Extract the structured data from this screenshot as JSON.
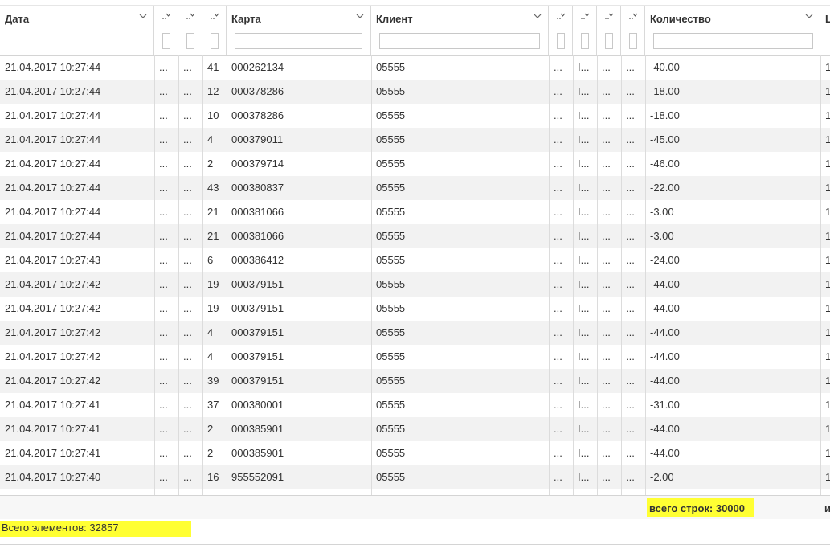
{
  "columns": {
    "date": "Дата",
    "card": "Карта",
    "client": "Клиент",
    "quantity": "Количество",
    "cut": "L",
    "collapsed_marker": "..."
  },
  "rows": [
    {
      "date": "21.04.2017 10:27:44",
      "c1": "...",
      "c2": "...",
      "n": "41",
      "card": "000262134",
      "client": "05555",
      "c4": "...",
      "c5": "I...",
      "c6": "...",
      "c7": "...",
      "qty": "-40.00",
      "cut": "1"
    },
    {
      "date": "21.04.2017 10:27:44",
      "c1": "...",
      "c2": "...",
      "n": "12",
      "card": "000378286",
      "client": "05555",
      "c4": "...",
      "c5": "I...",
      "c6": "...",
      "c7": "...",
      "qty": "-18.00",
      "cut": "1"
    },
    {
      "date": "21.04.2017 10:27:44",
      "c1": "...",
      "c2": "...",
      "n": "10",
      "card": "000378286",
      "client": "05555",
      "c4": "...",
      "c5": "I...",
      "c6": "...",
      "c7": "...",
      "qty": "-18.00",
      "cut": "1"
    },
    {
      "date": "21.04.2017 10:27:44",
      "c1": "...",
      "c2": "...",
      "n": "4",
      "card": "000379011",
      "client": "05555",
      "c4": "...",
      "c5": "I...",
      "c6": "...",
      "c7": "...",
      "qty": "-45.00",
      "cut": "1"
    },
    {
      "date": "21.04.2017 10:27:44",
      "c1": "...",
      "c2": "...",
      "n": "2",
      "card": "000379714",
      "client": "05555",
      "c4": "...",
      "c5": "I...",
      "c6": "...",
      "c7": "...",
      "qty": "-46.00",
      "cut": "1"
    },
    {
      "date": "21.04.2017 10:27:44",
      "c1": "...",
      "c2": "...",
      "n": "43",
      "card": "000380837",
      "client": "05555",
      "c4": "...",
      "c5": "I...",
      "c6": "...",
      "c7": "...",
      "qty": "-22.00",
      "cut": "1"
    },
    {
      "date": "21.04.2017 10:27:44",
      "c1": "...",
      "c2": "...",
      "n": "21",
      "card": "000381066",
      "client": "05555",
      "c4": "...",
      "c5": "I...",
      "c6": "...",
      "c7": "...",
      "qty": "-3.00",
      "cut": "1"
    },
    {
      "date": "21.04.2017 10:27:44",
      "c1": "...",
      "c2": "...",
      "n": "21",
      "card": "000381066",
      "client": "05555",
      "c4": "...",
      "c5": "I...",
      "c6": "...",
      "c7": "...",
      "qty": "-3.00",
      "cut": "1"
    },
    {
      "date": "21.04.2017 10:27:43",
      "c1": "...",
      "c2": "...",
      "n": "6",
      "card": "000386412",
      "client": "05555",
      "c4": "...",
      "c5": "I...",
      "c6": "...",
      "c7": "...",
      "qty": "-24.00",
      "cut": "1"
    },
    {
      "date": "21.04.2017 10:27:42",
      "c1": "...",
      "c2": "...",
      "n": "19",
      "card": "000379151",
      "client": "05555",
      "c4": "...",
      "c5": "I...",
      "c6": "...",
      "c7": "...",
      "qty": "-44.00",
      "cut": "1"
    },
    {
      "date": "21.04.2017 10:27:42",
      "c1": "...",
      "c2": "...",
      "n": "19",
      "card": "000379151",
      "client": "05555",
      "c4": "...",
      "c5": "I...",
      "c6": "...",
      "c7": "...",
      "qty": "-44.00",
      "cut": "1"
    },
    {
      "date": "21.04.2017 10:27:42",
      "c1": "...",
      "c2": "...",
      "n": "4",
      "card": "000379151",
      "client": "05555",
      "c4": "...",
      "c5": "I...",
      "c6": "...",
      "c7": "...",
      "qty": "-44.00",
      "cut": "1"
    },
    {
      "date": "21.04.2017 10:27:42",
      "c1": "...",
      "c2": "...",
      "n": "4",
      "card": "000379151",
      "client": "05555",
      "c4": "...",
      "c5": "I...",
      "c6": "...",
      "c7": "...",
      "qty": "-44.00",
      "cut": "1"
    },
    {
      "date": "21.04.2017 10:27:42",
      "c1": "...",
      "c2": "...",
      "n": "39",
      "card": "000379151",
      "client": "05555",
      "c4": "...",
      "c5": "I...",
      "c6": "...",
      "c7": "...",
      "qty": "-44.00",
      "cut": "1"
    },
    {
      "date": "21.04.2017 10:27:41",
      "c1": "...",
      "c2": "...",
      "n": "37",
      "card": "000380001",
      "client": "05555",
      "c4": "...",
      "c5": "I...",
      "c6": "...",
      "c7": "...",
      "qty": "-31.00",
      "cut": "1"
    },
    {
      "date": "21.04.2017 10:27:41",
      "c1": "...",
      "c2": "...",
      "n": "2",
      "card": "000385901",
      "client": "05555",
      "c4": "...",
      "c5": "I...",
      "c6": "...",
      "c7": "...",
      "qty": "-44.00",
      "cut": "1"
    },
    {
      "date": "21.04.2017 10:27:41",
      "c1": "...",
      "c2": "...",
      "n": "2",
      "card": "000385901",
      "client": "05555",
      "c4": "...",
      "c5": "I...",
      "c6": "...",
      "c7": "...",
      "qty": "-44.00",
      "cut": "1"
    },
    {
      "date": "21.04.2017 10:27:40",
      "c1": "...",
      "c2": "...",
      "n": "16",
      "card": "955552091",
      "client": "05555",
      "c4": "...",
      "c5": "I...",
      "c6": "...",
      "c7": "...",
      "qty": "-2.00",
      "cut": "1"
    }
  ],
  "footer": {
    "rows_total": "всего строк: 30000",
    "cut_label": "и"
  },
  "status": {
    "total_elements": "Всего элементов: 32857"
  },
  "colors": {
    "highlight": "#ffff33",
    "row_alt": "#f2f2f2",
    "border": "#d9d9d9"
  },
  "icons": {
    "sort": "chevron-down-icon",
    "collapsed_column": "collapsed-column-icon"
  }
}
